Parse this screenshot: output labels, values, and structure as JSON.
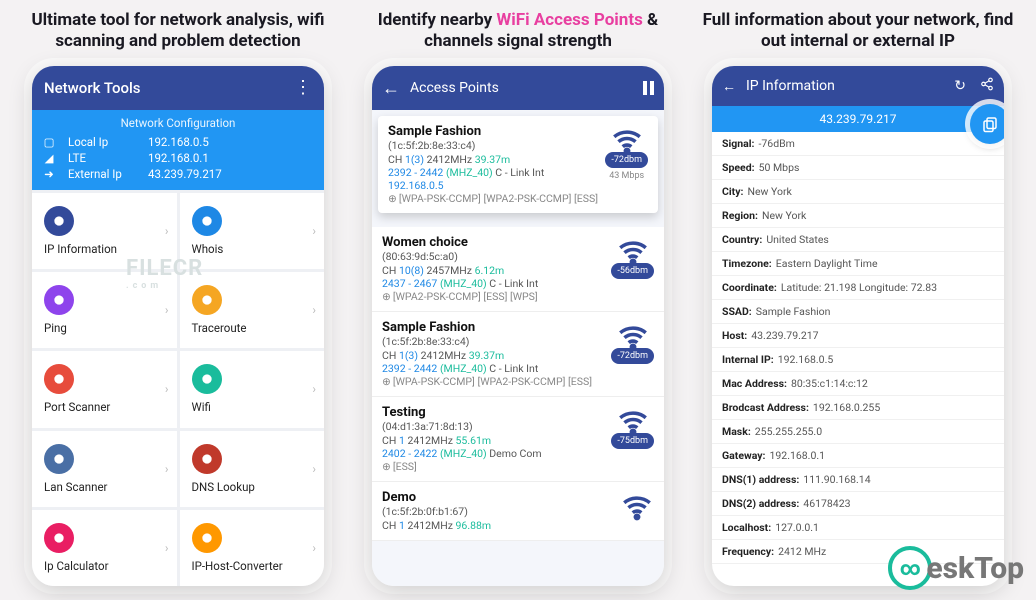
{
  "taglines": {
    "p1": "Ultimate tool for network analysis, wifi scanning and problem detection",
    "p2_pre": "Identify nearby ",
    "p2_hl": "WiFi Access Points",
    "p2_post": " & channels signal strength",
    "p3": "Full information about your network, find out internal or external IP"
  },
  "phone1": {
    "title": "Network Tools",
    "conf_title": "Network Configuration",
    "rows": [
      {
        "icon": "phone",
        "k": "Local Ip",
        "v": "192.168.0.5"
      },
      {
        "icon": "signal",
        "k": "LTE",
        "v": "192.168.0.1"
      },
      {
        "icon": "exit",
        "k": "External Ip",
        "v": "43.239.79.217"
      }
    ],
    "tools": [
      {
        "c": "c-blue-d",
        "icon": "info",
        "lbl": "IP Information"
      },
      {
        "c": "c-blue",
        "icon": "cloud",
        "lbl": "Whois"
      },
      {
        "c": "c-purple",
        "icon": "ping",
        "lbl": "Ping"
      },
      {
        "c": "c-orange",
        "icon": "route",
        "lbl": "Traceroute"
      },
      {
        "c": "c-red",
        "icon": "radar",
        "lbl": "Port Scanner"
      },
      {
        "c": "c-teal",
        "icon": "wifi",
        "lbl": "Wifi"
      },
      {
        "c": "c-steel",
        "icon": "lan",
        "lbl": "Lan Scanner"
      },
      {
        "c": "c-crimson",
        "icon": "dns",
        "lbl": "DNS Lookup"
      },
      {
        "c": "c-pink",
        "icon": "calc",
        "lbl": "Ip Calculator"
      },
      {
        "c": "c-amber",
        "icon": "conv",
        "lbl": "IP-Host-Converter"
      }
    ]
  },
  "phone2": {
    "title": "Access Points",
    "aps": [
      {
        "name": "Sample Fashion",
        "mac": "(1c:5f:2b:8e:33:c4)",
        "ch": "CH ",
        "chn": "1(3)",
        "freq": " 2412MHz ",
        "dist": "39.37m",
        "range": "2392 - 2442 ",
        "mhz": "(MHZ_40)",
        "link": " C - Link Int",
        "ip": "192.168.0.5",
        "sec": "[WPA-PSK-CCMP] [WPA2-PSK-CCMP] [ESS]",
        "dbm": "-72dbm",
        "mbps": "43 Mbps",
        "pop": true
      },
      {
        "name": "Women choice",
        "mac": "(80:63:9d:5c:a0)",
        "ch": "CH ",
        "chn": "10(8)",
        "freq": " 2457MHz ",
        "dist": "6.12m",
        "range": "2437 - 2467 ",
        "mhz": "(MHZ_40)",
        "link": " C - Link Int",
        "ip": "",
        "sec": "[WPA2-PSK-CCMP] [ESS] [WPS]",
        "dbm": "-56dbm",
        "mbps": ""
      },
      {
        "name": "Sample Fashion",
        "mac": "(1c:5f:2b:8e:33:c4)",
        "ch": "CH ",
        "chn": "1(3)",
        "freq": " 2412MHz ",
        "dist": "39.37m",
        "range": "2392 - 2442 ",
        "mhz": "(MHZ_40)",
        "link": " C - Link Int",
        "ip": "",
        "sec": "[WPA-PSK-CCMP] [WPA2-PSK-CCMP] [ESS]",
        "dbm": "-72dbm",
        "mbps": ""
      },
      {
        "name": "Testing",
        "mac": "(04:d1:3a:71:8d:13)",
        "ch": "CH ",
        "chn": "1",
        "freq": " 2412MHz ",
        "dist": "55.61m",
        "range": "2402 - 2422 ",
        "mhz": "(MHZ_40)",
        "link": " Demo Com",
        "ip": "",
        "sec": "[ESS]",
        "dbm": "-75dbm",
        "mbps": ""
      },
      {
        "name": "Demo",
        "mac": "(1c:5f:2b:0f:b1:67)",
        "ch": "CH ",
        "chn": "1",
        "freq": " 2412MHz ",
        "dist": "96.88m",
        "range": "",
        "mhz": "",
        "link": "",
        "ip": "",
        "sec": "",
        "dbm": "",
        "mbps": ""
      }
    ]
  },
  "phone3": {
    "title": "IP Information",
    "ip": "43.239.79.217",
    "rows": [
      {
        "k": "Signal:",
        "v": "-76dBm"
      },
      {
        "k": "Speed:",
        "v": "50 Mbps"
      },
      {
        "k": "City:",
        "v": "New York"
      },
      {
        "k": "Region:",
        "v": "New York"
      },
      {
        "k": "Country:",
        "v": "United States"
      },
      {
        "k": "Timezone:",
        "v": "Eastern Daylight Time"
      },
      {
        "k": "Coordinate:",
        "v": "Latitude: 21.198    Longitude: 72.83"
      },
      {
        "k": "SSAD:",
        "v": "Sample Fashion"
      },
      {
        "k": "Host:",
        "v": "43.239.79.217"
      },
      {
        "k": "Internal IP:",
        "v": "192.168.0.5"
      },
      {
        "k": "Mac Address:",
        "v": "80:35:c1:14:c:12"
      },
      {
        "k": "Brodcast Address:",
        "v": "192.168.0.255"
      },
      {
        "k": "Mask:",
        "v": "255.255.255.0"
      },
      {
        "k": "Gateway:",
        "v": "192.168.0.1"
      },
      {
        "k": "DNS(1) address:",
        "v": "111.90.168.14"
      },
      {
        "k": "DNS(2) address:",
        "v": "46178423"
      },
      {
        "k": "Localhost:",
        "v": "127.0.0.1"
      },
      {
        "k": "Frequency:",
        "v": "2412 MHz"
      }
    ]
  },
  "watermark": {
    "main": "FILECR",
    "sub": ".com"
  },
  "brlogo": {
    "text": "eskTop"
  }
}
